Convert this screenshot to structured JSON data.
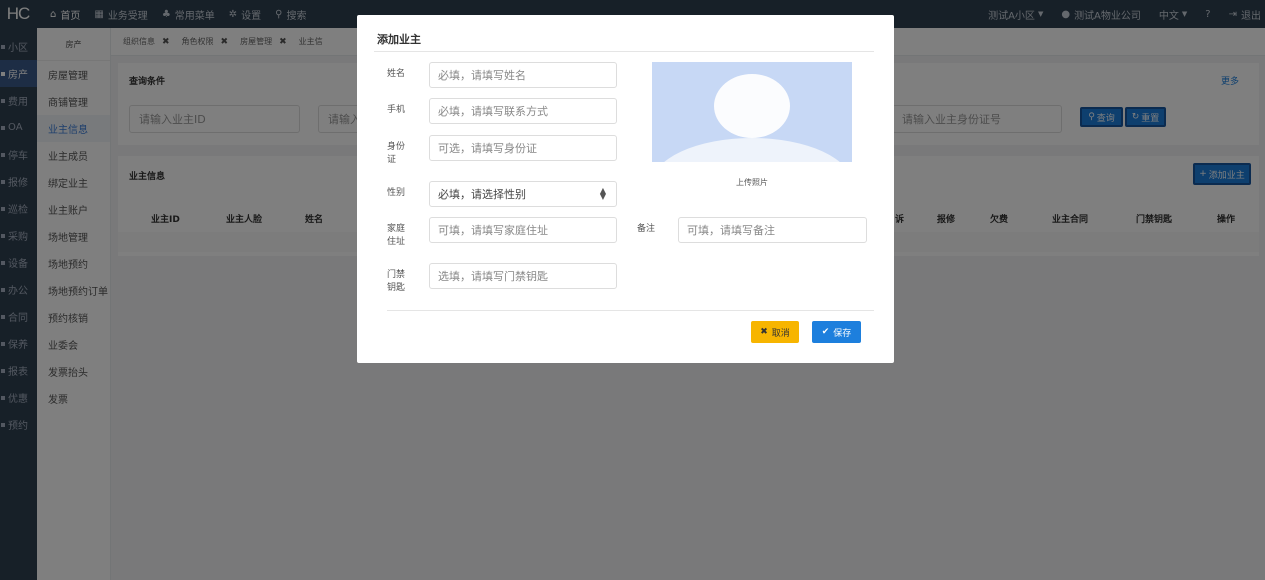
{
  "topbar": {
    "logo": "HC",
    "nav": [
      {
        "icon": "home-icon",
        "glyph": "⌂",
        "label": "首页"
      },
      {
        "icon": "calculator-icon",
        "glyph": "▦",
        "label": "业务受理"
      },
      {
        "icon": "sitemap-icon",
        "glyph": "♣",
        "label": "常用菜单"
      },
      {
        "icon": "gear-icon",
        "glyph": "✲",
        "label": "设置"
      },
      {
        "icon": "search-icon",
        "glyph": "⚲",
        "label": "搜索"
      }
    ],
    "community": "测试A小区",
    "company": "测试A物业公司",
    "language": "中文",
    "help_glyph": "?",
    "logout": "退出"
  },
  "sidebar1": [
    {
      "label": "小区"
    },
    {
      "label": "房产",
      "active": true
    },
    {
      "label": "费用"
    },
    {
      "label": "OA"
    },
    {
      "label": "停车"
    },
    {
      "label": "报修"
    },
    {
      "label": "巡检"
    },
    {
      "label": "采购"
    },
    {
      "label": "设备"
    },
    {
      "label": "办公"
    },
    {
      "label": "合同"
    },
    {
      "label": "保养"
    },
    {
      "label": "报表"
    },
    {
      "label": "优惠"
    },
    {
      "label": "预约"
    }
  ],
  "sidebar2": {
    "header": "房产",
    "items": [
      {
        "label": "房屋管理"
      },
      {
        "label": "商铺管理"
      },
      {
        "label": "业主信息",
        "active": true
      },
      {
        "label": "业主成员"
      },
      {
        "label": "绑定业主"
      },
      {
        "label": "业主账户"
      },
      {
        "label": "场地管理"
      },
      {
        "label": "场地预约"
      },
      {
        "label": "场地预约订单"
      },
      {
        "label": "预约核销"
      },
      {
        "label": "业委会"
      },
      {
        "label": "发票抬头"
      },
      {
        "label": "发票"
      }
    ]
  },
  "tabs": [
    {
      "label": "组织信息"
    },
    {
      "label": "角色权限"
    },
    {
      "label": "房屋管理"
    },
    {
      "label": "业主信"
    }
  ],
  "query": {
    "title": "查询条件",
    "more": "更多",
    "owner_id_placeholder": "请输入业主ID",
    "second_placeholder": "请输入",
    "id_card_placeholder": "请输入业主身份证号",
    "search_label": "查询",
    "reset_label": "重置"
  },
  "owner_table": {
    "title": "业主信息",
    "add_label": "添加业主",
    "columns_left": [
      "业主ID",
      "业主人脸",
      "姓名"
    ],
    "columns_right": [
      "诉",
      "报修",
      "欠费",
      "业主合同",
      "门禁钥匙",
      "操作"
    ]
  },
  "modal": {
    "title": "添加业主",
    "fields": {
      "name": {
        "label": "姓名",
        "placeholder": "必填，请填写姓名"
      },
      "phone": {
        "label": "手机",
        "placeholder": "必填，请填写联系方式"
      },
      "idcard": {
        "label": "身份证",
        "placeholder": "可选，请填写身份证"
      },
      "gender": {
        "label": "性别",
        "value": "必填，请选择性别"
      },
      "address": {
        "label": "家庭住址",
        "placeholder": "可填，请填写家庭住址"
      },
      "remark": {
        "label": "备注",
        "placeholder": "可填，请填写备注"
      },
      "key": {
        "label": "门禁钥匙",
        "placeholder": "选填，请填写门禁钥匙"
      }
    },
    "photo_caption": "上传照片",
    "cancel_label": "取消",
    "save_label": "保存",
    "colors": {
      "cancel": "#f7b500",
      "save": "#1d7fdd",
      "photo": "#c7d8f5"
    }
  }
}
